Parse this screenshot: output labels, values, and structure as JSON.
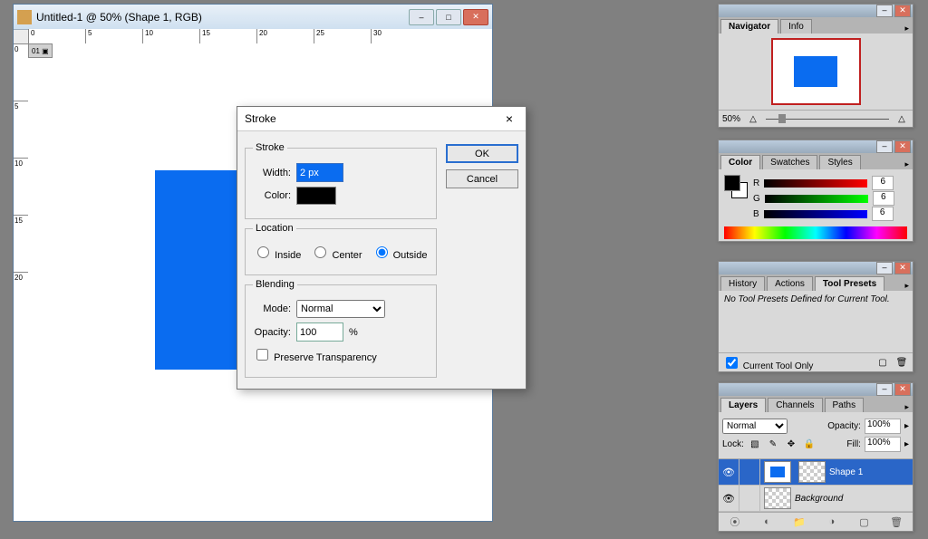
{
  "doc_window": {
    "title": "Untitled-1 @ 50% (Shape 1, RGB)",
    "tab": "01",
    "ruler_h": [
      "0",
      "5",
      "10",
      "15",
      "20",
      "25",
      "30"
    ],
    "ruler_v": [
      "0",
      "5",
      "10",
      "15",
      "20"
    ]
  },
  "dialog": {
    "title": "Stroke",
    "group_stroke": "Stroke",
    "width_label": "Width:",
    "width_value": "2 px",
    "color_label": "Color:",
    "group_location": "Location",
    "loc_inside": "Inside",
    "loc_center": "Center",
    "loc_outside": "Outside",
    "loc_selected": "outside",
    "group_blending": "Blending",
    "mode_label": "Mode:",
    "mode_value": "Normal",
    "opacity_label": "Opacity:",
    "opacity_value": "100",
    "pct": "%",
    "preserve": "Preserve Transparency",
    "ok": "OK",
    "cancel": "Cancel"
  },
  "navigator": {
    "tab_nav": "Navigator",
    "tab_info": "Info",
    "zoom": "50%"
  },
  "color": {
    "tab_color": "Color",
    "tab_swatches": "Swatches",
    "tab_styles": "Styles",
    "channels": [
      {
        "k": "R",
        "v": "6"
      },
      {
        "k": "G",
        "v": "6"
      },
      {
        "k": "B",
        "v": "6"
      }
    ]
  },
  "toolpresets": {
    "tab_history": "History",
    "tab_actions": "Actions",
    "tab_tool": "Tool Presets",
    "msg": "No Tool Presets Defined for Current Tool.",
    "current_only": "Current Tool Only"
  },
  "layers": {
    "tab_layers": "Layers",
    "tab_channels": "Channels",
    "tab_paths": "Paths",
    "blend": "Normal",
    "opacity_label": "Opacity:",
    "opacity_value": "100%",
    "lock_label": "Lock:",
    "fill_label": "Fill:",
    "fill_value": "100%",
    "items": [
      {
        "name": "Shape 1",
        "sel": true
      },
      {
        "name": "Background",
        "sel": false
      }
    ]
  }
}
